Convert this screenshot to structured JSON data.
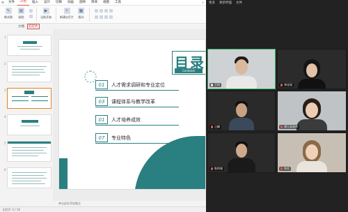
{
  "app": {
    "menu_items": [
      "文件",
      "开始",
      "插入",
      "设计",
      "切换",
      "动画",
      "放映",
      "审阅",
      "视图",
      "工具"
    ],
    "ribbon": {
      "format_painter": "格式刷",
      "paste": "粘贴",
      "new_slide": "新建幻灯片",
      "layout": "版式",
      "current_slide": "当前开始"
    },
    "panel_tabs": [
      "大纲",
      "幻灯片"
    ],
    "thumb_numbers": [
      "1",
      "2",
      "3",
      "4",
      "5",
      "6"
    ],
    "notes_placeholder": "单击此处添加备注",
    "status_text": "幻灯片 3 / 14"
  },
  "slide": {
    "title": "目录",
    "subtitle": "Contents",
    "items": [
      {
        "num": "01",
        "text": "人才需求调研和专业定位"
      },
      {
        "num": "03",
        "text": "课程体系与教学改革"
      },
      {
        "num": "01",
        "text": "人才培养成效"
      },
      {
        "num": "07",
        "text": "专业特色"
      }
    ]
  },
  "meeting": {
    "top": [
      "更多",
      "更新界面",
      "文件"
    ],
    "participants": [
      {
        "name": "王柯",
        "muted": false,
        "active": true
      },
      {
        "name": "李佳瑶",
        "muted": true,
        "active": false
      },
      {
        "name": "江峰",
        "muted": true,
        "active": false
      },
      {
        "name": "望江县老师",
        "muted": true,
        "active": false
      },
      {
        "name": "陈四湖",
        "muted": true,
        "active": false
      },
      {
        "name": "李珍",
        "muted": true,
        "active": false
      }
    ]
  },
  "colors": {
    "accent": "#2a7f80",
    "active_border": "#33b36b",
    "menu_active": "#d9534f"
  }
}
